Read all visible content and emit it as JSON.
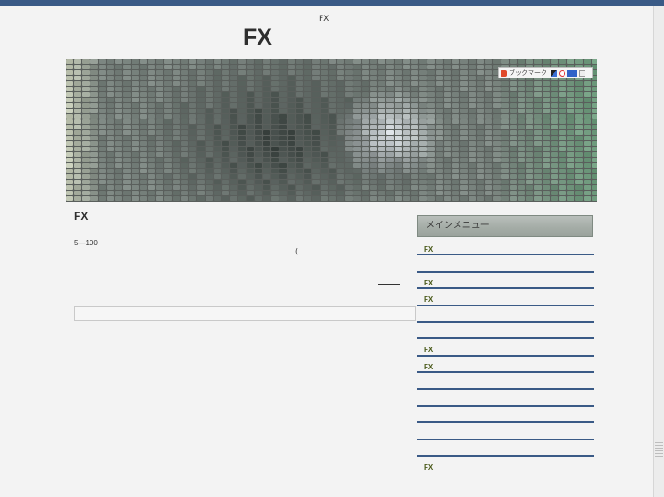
{
  "header": {
    "tagline": "FX",
    "site_title": "FX"
  },
  "bookmark_bar": {
    "label": "ブックマーク",
    "icons": [
      "bookmark-icon",
      "delicious-icon",
      "hatena-icon",
      "livedoor-clip-icon",
      "add-icon"
    ]
  },
  "post": {
    "title": "FX",
    "text": "5—100",
    "paren": "("
  },
  "sidebar": {
    "menu_title": "メインメニュー",
    "items": [
      {
        "label": "FX"
      },
      {
        "label": ""
      },
      {
        "label": "FX"
      },
      {
        "label": "FX"
      },
      {
        "label": ""
      },
      {
        "label": ""
      },
      {
        "label": "FX"
      },
      {
        "label": "FX"
      },
      {
        "label": ""
      },
      {
        "label": ""
      },
      {
        "label": ""
      },
      {
        "label": ""
      },
      {
        "label": ""
      },
      {
        "label": "FX"
      }
    ]
  },
  "colors": {
    "top_bar": "#3a5a86",
    "menu_divider": "#3a5a86",
    "menu_link": "#4a5a1a",
    "background": "#f3f3f3"
  }
}
